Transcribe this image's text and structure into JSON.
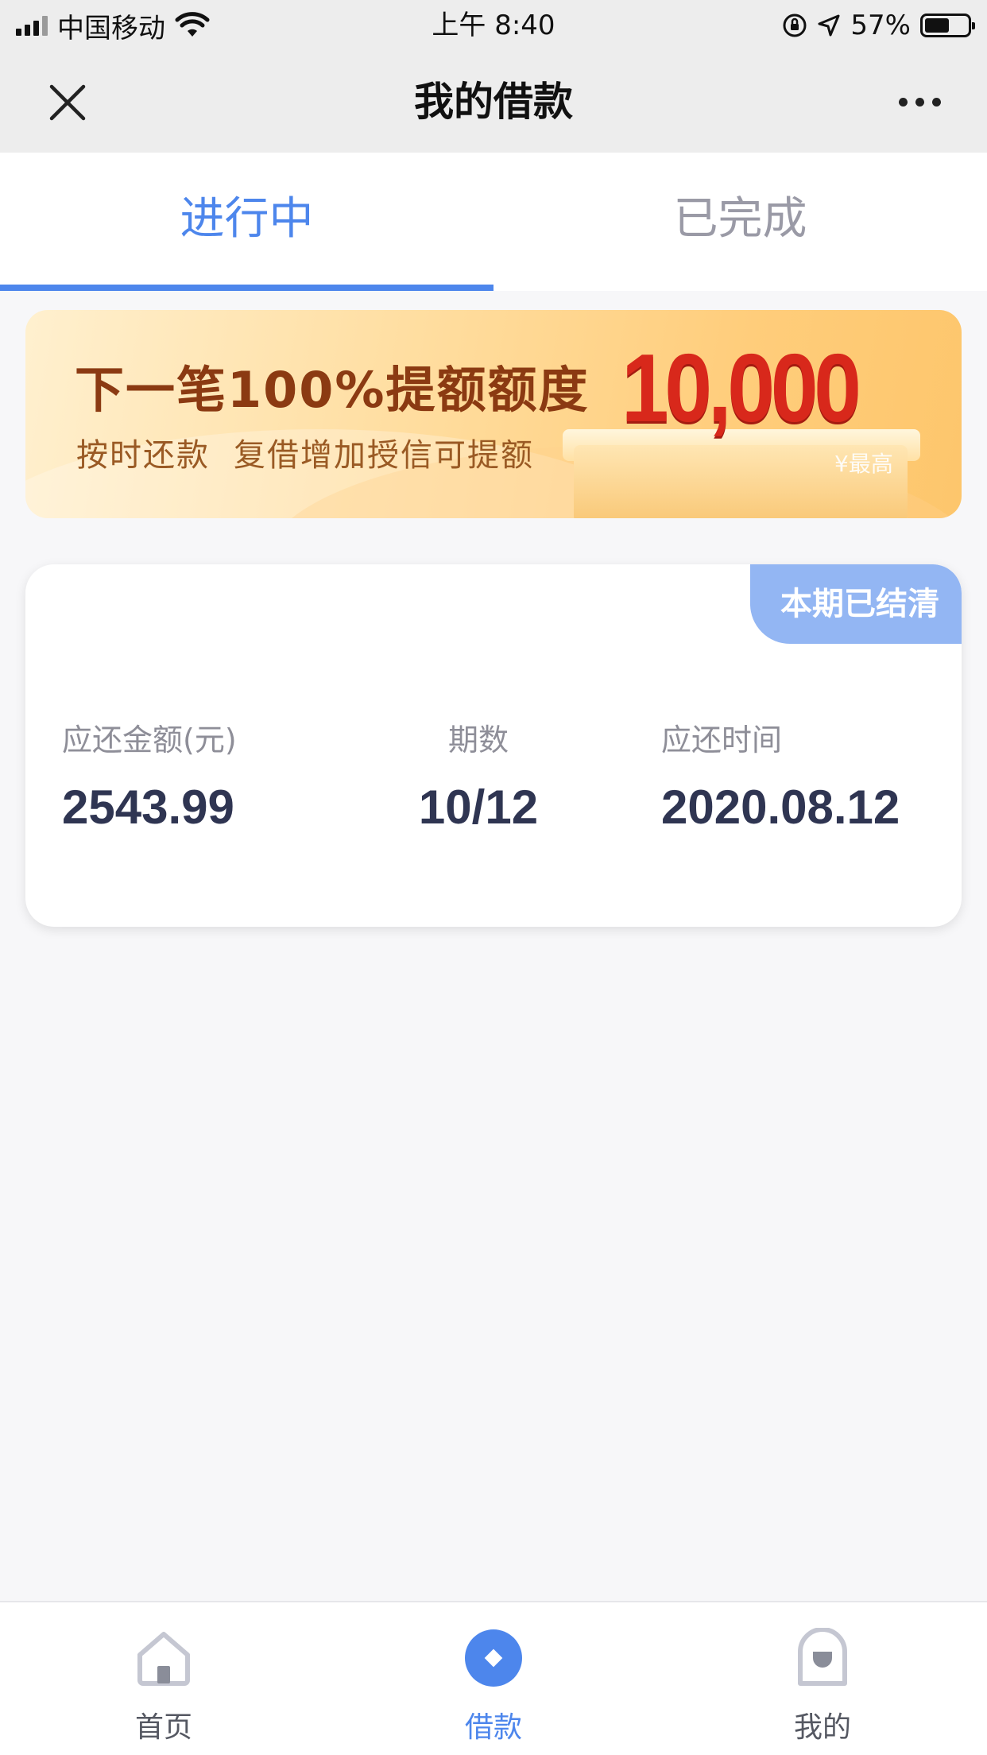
{
  "status_bar": {
    "carrier": "中国移动",
    "time": "上午 8:40",
    "battery": "57%"
  },
  "nav": {
    "title": "我的借款"
  },
  "tabs": [
    {
      "label": "进行中",
      "active": true
    },
    {
      "label": "已完成",
      "active": false
    }
  ],
  "banner": {
    "title": "下一笔100%提额额度",
    "subtitle_part1": "按时还款",
    "subtitle_part2": "复借增加授信可提额",
    "amount": "10,000",
    "amount_note": "¥最高"
  },
  "loan_card": {
    "status_badge": "本期已结清",
    "amount_label": "应还金额(元)",
    "amount_value": "2543.99",
    "period_label": "期数",
    "period_value": "10/12",
    "due_label": "应还时间",
    "due_value": "2020.08.12"
  },
  "tabbar": {
    "items": [
      {
        "label": "首页",
        "icon": "home-icon",
        "active": false
      },
      {
        "label": "借款",
        "icon": "loan-diamond-icon",
        "active": true
      },
      {
        "label": "我的",
        "icon": "profile-bag-icon",
        "active": false
      }
    ]
  },
  "colors": {
    "accent": "#4d86ec",
    "badge": "#93b6f3",
    "banner_amount": "#d8281b",
    "value_text": "#2f3552"
  }
}
